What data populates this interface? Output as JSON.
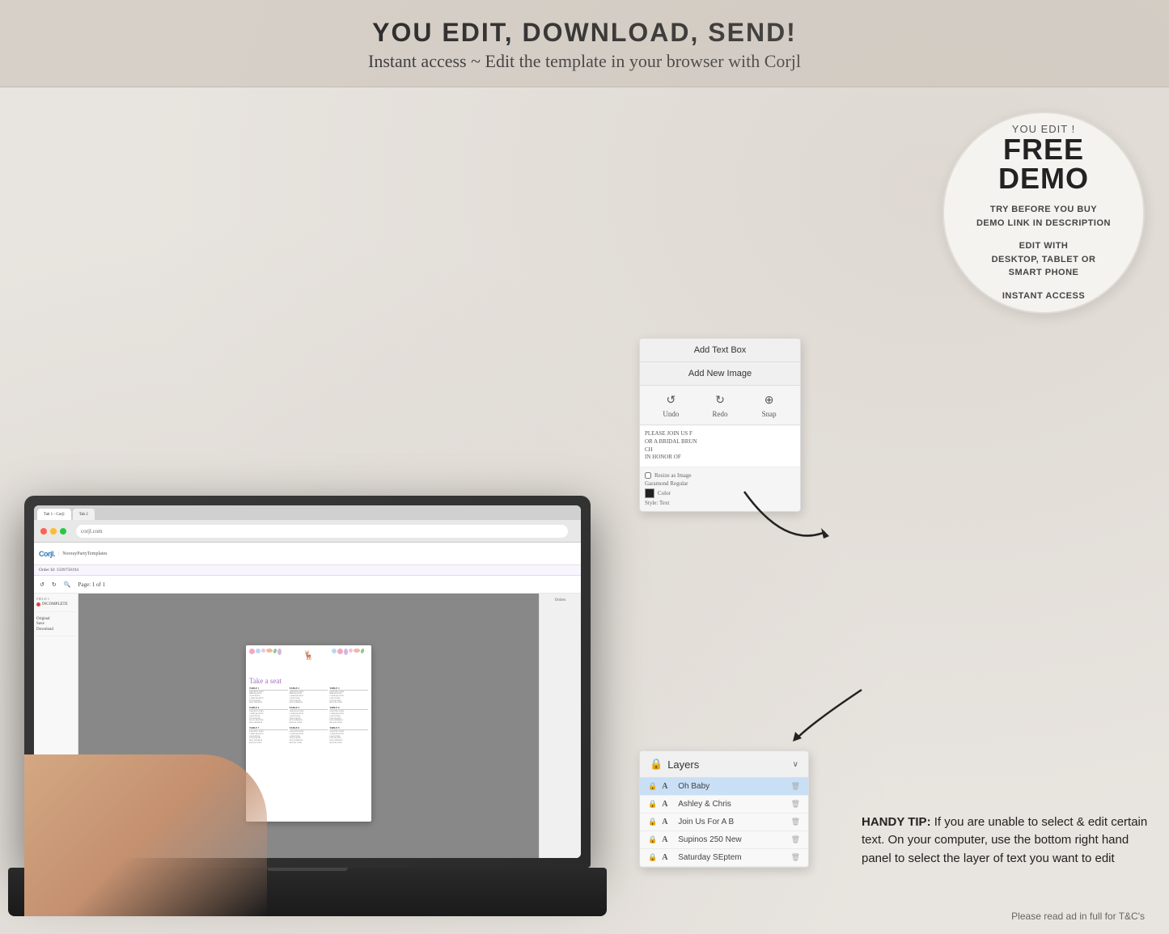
{
  "header": {
    "main_title": "YOU EDIT, DOWNLOAD, SEND!",
    "subtitle": "Instant access ~ Edit the template in your browser with Corjl"
  },
  "free_demo": {
    "you_edit": "YOU EDIT !",
    "title": "FREE DEMO",
    "line1": "TRY BEFORE YOU BUY",
    "line2": "DEMO LINK IN DESCRIPTION",
    "line3": "EDIT WITH",
    "line4": "DESKTOP, TABLET OR",
    "line5": "SMART PHONE",
    "line6": "INSTANT ACCESS"
  },
  "corjl_panel": {
    "add_text_box": "Add Text Box",
    "add_new_image": "Add New Image",
    "undo": "Undo",
    "redo": "Redo",
    "snap": "Snap",
    "preview_text_line1": "PLEASE JOIN US F",
    "preview_text_line2": "OR A BRIDAL BRUN",
    "preview_text_line3": "CH",
    "preview_text_line4": "IN HONOR OF",
    "resize_image_label": "Resize as Image",
    "font_label": "Garamond Regular",
    "style_label": "Style: Text"
  },
  "layers_panel": {
    "title": "Layers",
    "chevron": "∨",
    "items": [
      {
        "lock": "🔒",
        "type": "A",
        "name": "Oh Baby",
        "delete": "🗑"
      },
      {
        "lock": "🔒",
        "type": "A",
        "name": "Ashley & Chris",
        "delete": "🗑"
      },
      {
        "lock": "🔒",
        "type": "A",
        "name": "Join Us For A B",
        "delete": "🗑"
      },
      {
        "lock": "🔒",
        "type": "A",
        "name": "Supinos 250 New",
        "delete": "🗑"
      },
      {
        "lock": "🔒",
        "type": "A",
        "name": "Saturday SEptem",
        "delete": "🗑"
      }
    ]
  },
  "handy_tip": {
    "label": "HANDY TIP:",
    "text": " If you are unable to select & edit certain text. On your computer, use the bottom right hand panel to select the layer of text you want to edit"
  },
  "bottom_note": {
    "text": "Please read ad in full for T&C's"
  },
  "seating_chart": {
    "title": "Take a seat",
    "tables": [
      {
        "label": "TABLE 1",
        "names": [
          "SAMANTHA JONES",
          "MIKE BRAXTON",
          "JASON DTLER",
          "CARRIE BRAXTON",
          "TAYLOR ROHN",
          "NICK ANDERSON"
        ]
      },
      {
        "label": "TABLE 2",
        "names": [
          "SAMANTHA JONES",
          "MIKE BRAXTON",
          "CARRIE BRAXTON",
          "JASON DTLER",
          "TAYLOR ROHN",
          "NICK ANDERSON"
        ]
      },
      {
        "label": "TABLE 3",
        "names": [
          "SAMANTHA JONES",
          "MIKE BRAXTON",
          "CARRIE BRAXTON",
          "JASON DTLER",
          "TAYLOR ROHN",
          "MICHAEL JONES"
        ]
      },
      {
        "label": "TABLE 4",
        "names": [
          "SAMANTHA JONES",
          "CARRIE BRAXTON",
          "JASON DTLER",
          "TAYLOR ROHN",
          "TALALA BRAXTER",
          "NICK ANDERSON"
        ]
      },
      {
        "label": "TABLE 5",
        "names": [
          "SAMANTHA JONES",
          "CARRIE BRAXTON",
          "JASON DTLER",
          "TAYLOR ROHN",
          "NICK ANDERSON",
          "MICHAEL JONES"
        ]
      },
      {
        "label": "TABLE 6",
        "names": [
          "SAMANTHA JONES",
          "CARRIE BRAXTON",
          "JASON DTLER",
          "TAYLOR ROHN",
          "NICK ANDERSON",
          "MICHAEL JONES"
        ]
      },
      {
        "label": "TABLE 7",
        "names": [
          "SAMANTHA JONES",
          "CARRIE BRAXTON",
          "JASON DTLER",
          "TAYLOR ROHN",
          "NICK ANDERSON",
          "MICHAEL JONES"
        ]
      },
      {
        "label": "TABLE 8",
        "names": [
          "SAMANTHA JONES",
          "CARRIE BRAXTON",
          "JASON DTLER",
          "TAYLOR ROHN",
          "NICK ANDERSON",
          "MICHAEL JONES"
        ]
      },
      {
        "label": "TABLE 9",
        "names": [
          "SAMANTHA JONES",
          "CARRIE BRAXTON",
          "JASON DTLER",
          "TAYLOR ROHN",
          "NICK ANDERSON",
          "MICHAEL JONES"
        ]
      }
    ]
  }
}
